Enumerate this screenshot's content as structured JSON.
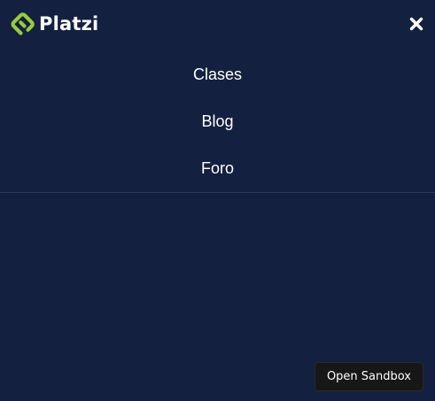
{
  "header": {
    "logo_text": "Platzi",
    "logo_icon": "platzi-logo-icon",
    "close_icon": "close-icon"
  },
  "nav": {
    "items": [
      {
        "label": "Clases"
      },
      {
        "label": "Blog"
      },
      {
        "label": "Foro"
      }
    ]
  },
  "sandbox": {
    "label": "Open Sandbox"
  },
  "colors": {
    "background": "#13203f",
    "brand_green": "#98ca3f",
    "text": "#ffffff",
    "divider": "#2c3a5a",
    "sandbox_button_bg": "#171717"
  }
}
